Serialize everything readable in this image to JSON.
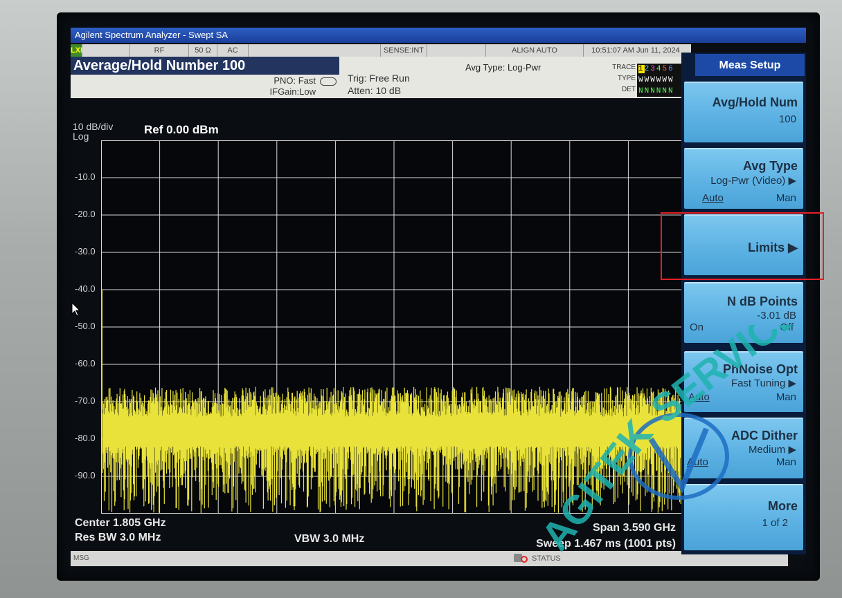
{
  "window": {
    "title": "Agilent Spectrum Analyzer - Swept SA"
  },
  "status_bar": {
    "lxi": "LXI",
    "rf": "RF",
    "impedance": "50 Ω",
    "coupling": "AC",
    "sense": "SENSE:INT",
    "align": "ALIGN AUTO",
    "datetime": "10:51:07 AM Jun 11, 2024"
  },
  "info": {
    "measurement_title": "Average/Hold Number 100",
    "avg_type": "Avg Type: Log-Pwr",
    "pno": "PNO: Fast",
    "ifgain": "IFGain:Low",
    "trig": "Trig: Free Run",
    "atten": "Atten: 10 dB",
    "trace_label": "TRACE",
    "type_label": "TYPE",
    "det_label": "DET",
    "trace_numbers": [
      "1",
      "2",
      "3",
      "4",
      "5",
      "6"
    ],
    "trace_type": "WWWWWW",
    "trace_det": "NNNNNN"
  },
  "display": {
    "scale": "10 dB/div",
    "scale_type": "Log",
    "ref": "Ref 0.00 dBm",
    "y_labels": [
      "-10.0",
      "-20.0",
      "-30.0",
      "-40.0",
      "-50.0",
      "-60.0",
      "-70.0",
      "-80.0",
      "-90.0"
    ],
    "center": "Center 1.805 GHz",
    "res_bw": "Res BW 3.0 MHz",
    "vbw": "VBW 3.0 MHz",
    "span": "Span 3.590 GHz",
    "sweep": "Sweep 1.467 ms (1001 pts)"
  },
  "chart_data": {
    "type": "line",
    "title": "Ref 0.00 dBm",
    "ylabel": "10 dB/div Log",
    "xlabel": "",
    "ylim": [
      -100,
      0
    ],
    "x_range_ghz": [
      0.01,
      3.6
    ],
    "series": [
      {
        "noise_floor_dbm": -80,
        "peak_dbm": -70,
        "trough_dbm": -98
      }
    ],
    "grid": true,
    "trace_color": "#e8e23a"
  },
  "softkeys": {
    "menu_title": "Meas Setup",
    "keys": [
      {
        "label": "Avg/Hold Num",
        "value": "100"
      },
      {
        "label": "Avg Type",
        "value": "Log-Pwr (Video) ▶",
        "auto": "Auto",
        "man": "Man"
      },
      {
        "label": "Limits ▶"
      },
      {
        "label": "N dB Points",
        "value": "-3.01 dB",
        "on": "On",
        "off": "Off"
      },
      {
        "label": "PhNoise Opt",
        "value": "Fast Tuning ▶",
        "auto": "Auto",
        "man": "Man"
      },
      {
        "label": "ADC Dither",
        "value": "Medium ▶",
        "auto": "Auto",
        "man": "Man"
      },
      {
        "label": "More",
        "value": "1 of 2"
      }
    ]
  },
  "msg_bar": {
    "msg": "MSG",
    "status": "STATUS"
  },
  "watermark": {
    "text1": "AGITEK",
    "text2": "SERVICE"
  },
  "colors": {
    "trace": "#e8e23a",
    "softkey": "#5db2e3",
    "highlight": "#e51f26",
    "title_bar": "#2d5fc4"
  }
}
